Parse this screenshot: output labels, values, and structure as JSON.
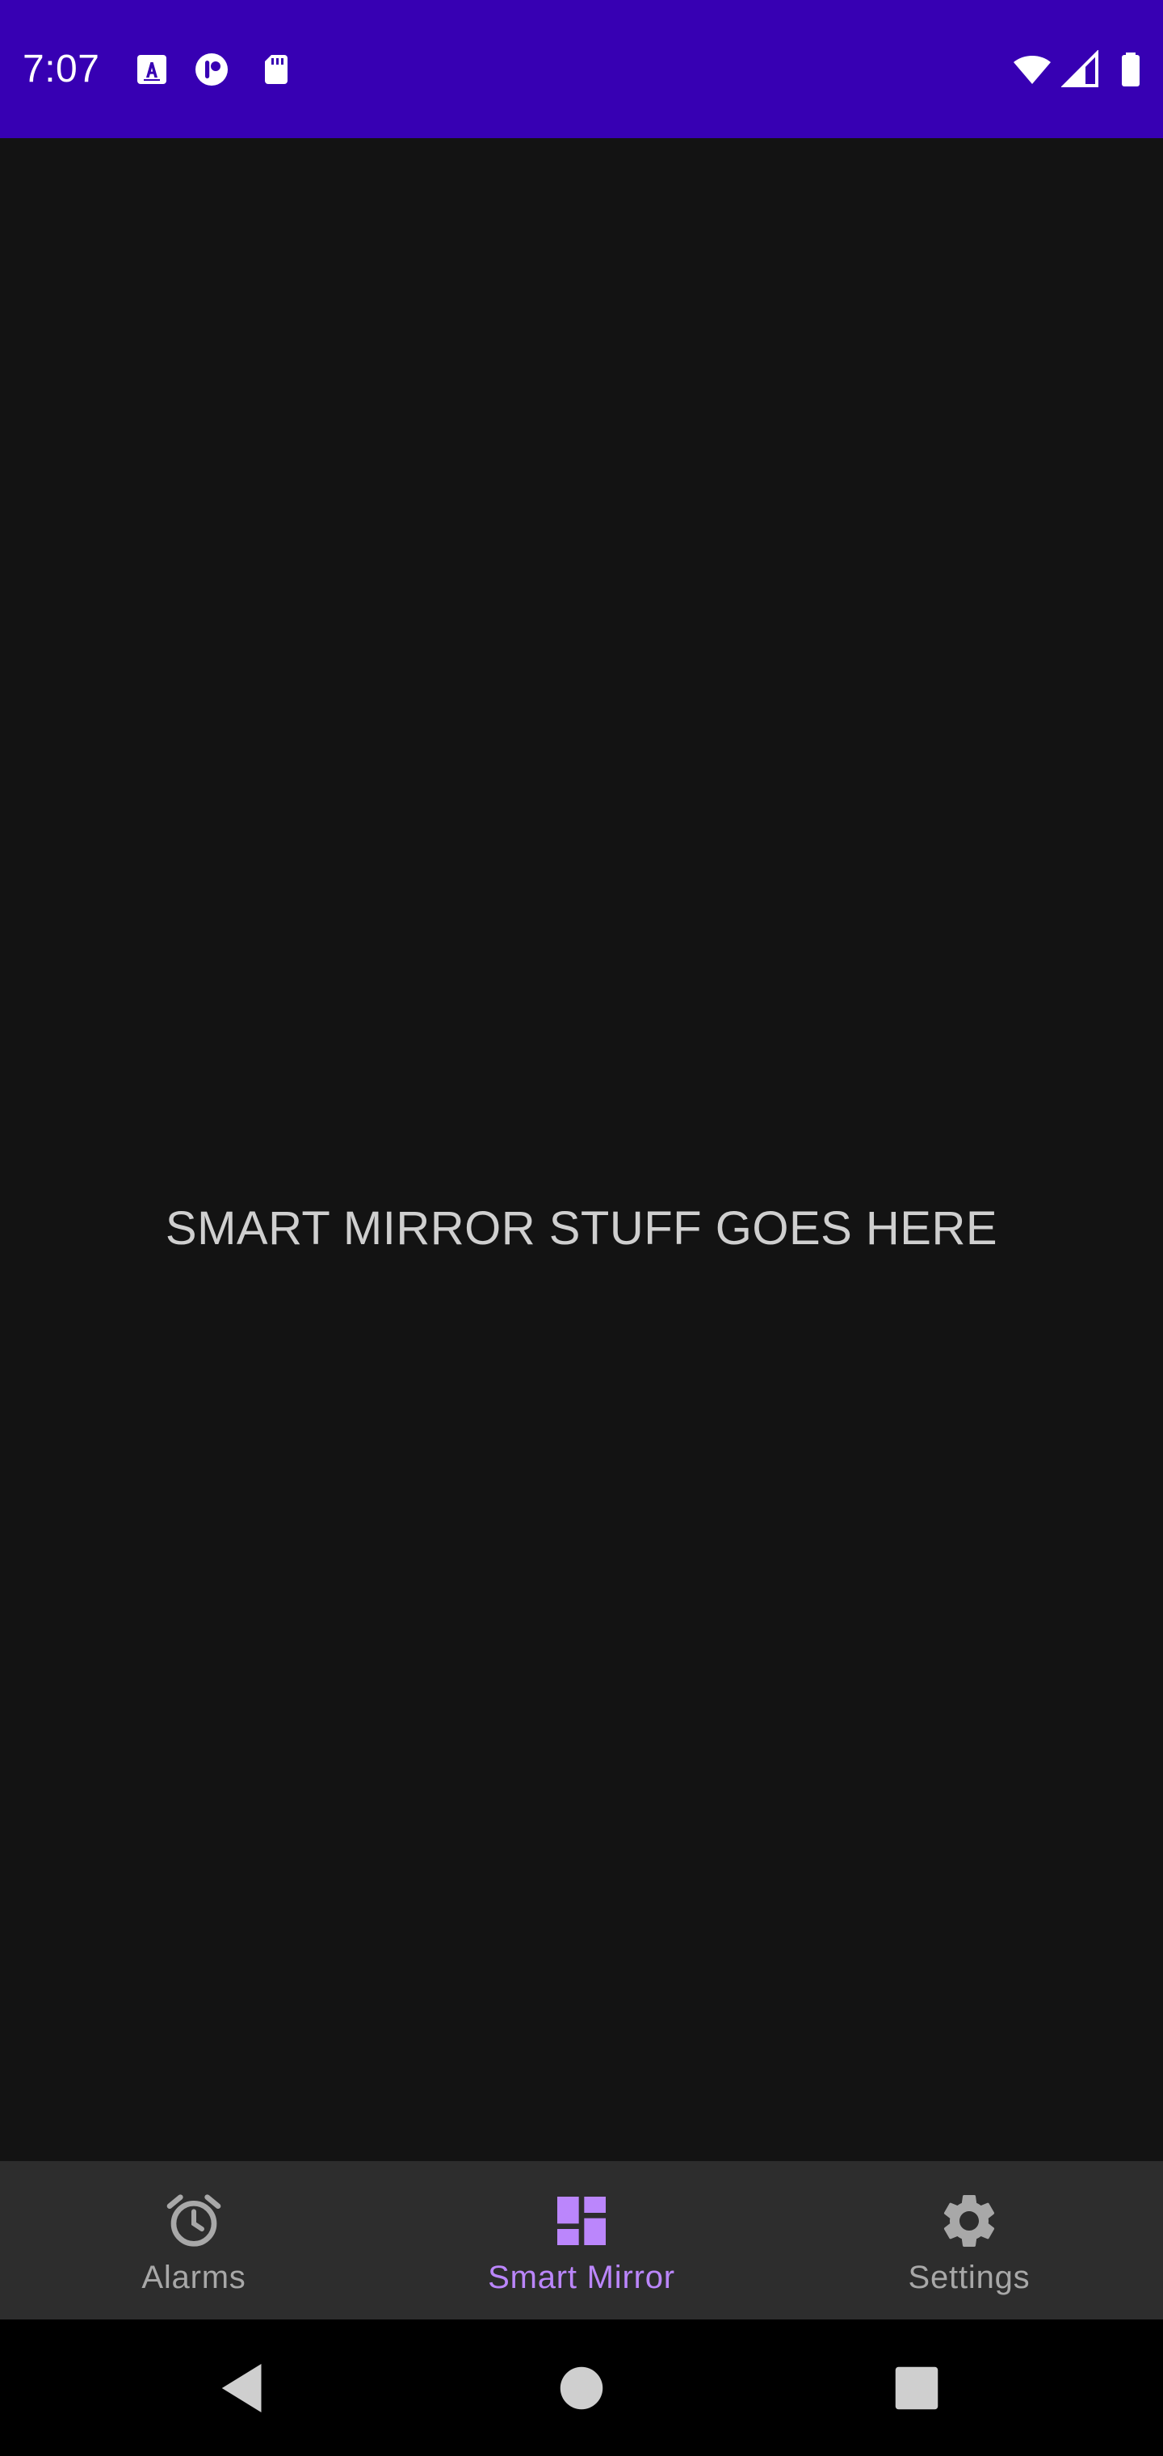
{
  "status_bar": {
    "time": "7:07",
    "background": "#3700b3",
    "icons": [
      "font-a-icon",
      "assistant-icon",
      "sd-card-icon",
      "wifi-icon",
      "cell-signal-icon",
      "battery-icon"
    ]
  },
  "main": {
    "placeholder": "SMART MIRROR STUFF GOES HERE"
  },
  "bottom_nav": {
    "accent": "#bb86fc",
    "items": [
      {
        "label": "Alarms",
        "icon": "alarm-clock-icon",
        "active": false
      },
      {
        "label": "Smart Mirror",
        "icon": "dashboard-icon",
        "active": true
      },
      {
        "label": "Settings",
        "icon": "gear-icon",
        "active": false
      }
    ]
  },
  "system_nav": {
    "buttons": [
      "back-icon",
      "home-icon",
      "recents-icon"
    ]
  }
}
